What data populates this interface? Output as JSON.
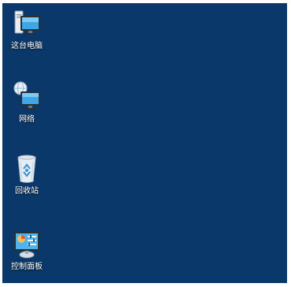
{
  "desktop": {
    "background_color": "#0b386a",
    "icons": [
      {
        "label": "这台电脑",
        "icon": "computer-icon"
      },
      {
        "label": "网络",
        "icon": "network-icon"
      },
      {
        "label": "回收站",
        "icon": "recycle-bin-icon"
      },
      {
        "label": "控制面板",
        "icon": "control-panel-icon"
      }
    ]
  }
}
